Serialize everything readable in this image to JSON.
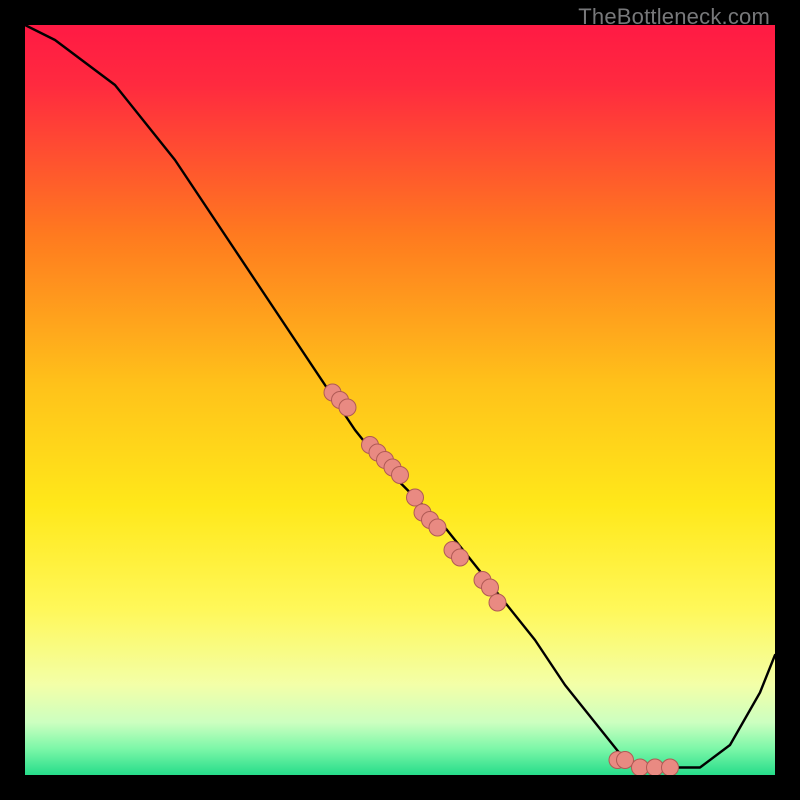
{
  "watermark": "TheBottleneck.com",
  "colors": {
    "gradient_top": "#ff1a44",
    "gradient_mid_upper": "#ff9c1a",
    "gradient_mid": "#ffe81a",
    "gradient_lower": "#f7ff7a",
    "gradient_green1": "#9dffb0",
    "gradient_green2": "#2fe58a",
    "curve": "#000000",
    "dot_fill": "#e98a82",
    "dot_stroke": "#b05a55"
  },
  "chart_data": {
    "type": "line",
    "title": "",
    "xlabel": "",
    "ylabel": "",
    "xlim": [
      0,
      100
    ],
    "ylim": [
      0,
      100
    ],
    "curve": {
      "x": [
        0,
        4,
        8,
        12,
        16,
        20,
        24,
        28,
        32,
        36,
        40,
        44,
        48,
        52,
        56,
        60,
        64,
        68,
        72,
        76,
        80,
        84,
        86,
        90,
        94,
        98,
        100
      ],
      "y": [
        100,
        98,
        95,
        92,
        87,
        82,
        76,
        70,
        64,
        58,
        52,
        46,
        41,
        37,
        33,
        28,
        23,
        18,
        12,
        7,
        2,
        1,
        1,
        1,
        4,
        11,
        16
      ]
    },
    "series": [
      {
        "name": "markers",
        "x": [
          41,
          42,
          43,
          46,
          47,
          48,
          49,
          50,
          52,
          53,
          54,
          55,
          57,
          58,
          61,
          62,
          63,
          79,
          80,
          82,
          84,
          86
        ],
        "y": [
          51,
          50,
          49,
          44,
          43,
          42,
          41,
          40,
          37,
          35,
          34,
          33,
          30,
          29,
          26,
          25,
          23,
          2,
          2,
          1,
          1,
          1
        ]
      }
    ]
  }
}
